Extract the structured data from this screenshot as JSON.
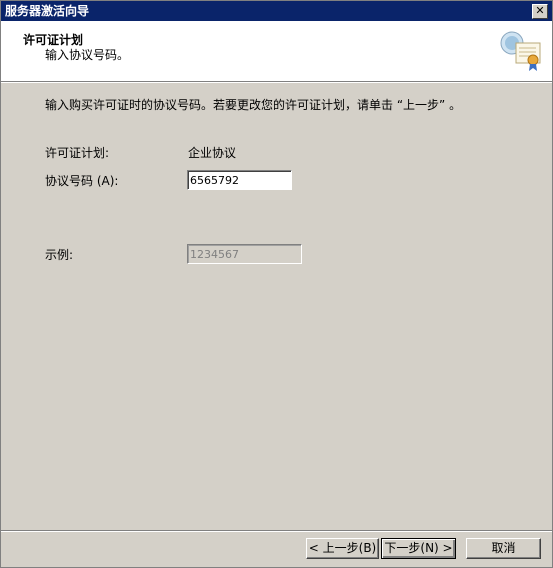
{
  "window": {
    "title": "服务器激活向导",
    "close_glyph": "✕"
  },
  "header": {
    "title": "许可证计划",
    "subtitle": "输入协议号码。",
    "icon": "certificate-computer-icon"
  },
  "body": {
    "instruction": "输入购买许可证时的协议号码。若要更改您的许可证计划，请单击 “上一步” 。",
    "plan_label": "许可证计划:",
    "plan_value": "企业协议",
    "agreement_label": "协议号码 (A):",
    "agreement_value": "6565792",
    "example_label": "示例:",
    "example_value": "1234567"
  },
  "buttons": {
    "back": "< 上一步(B)",
    "next": "下一步(N) >",
    "cancel": "取消"
  }
}
